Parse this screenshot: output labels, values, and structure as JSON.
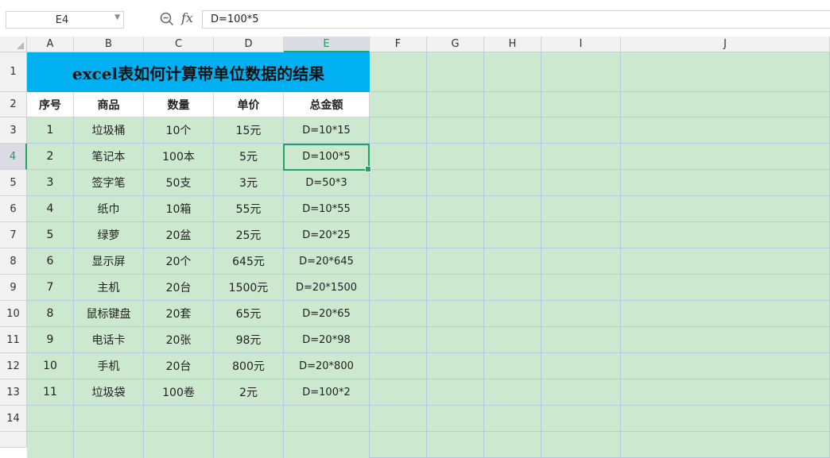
{
  "formula_bar": {
    "name_box": "E4",
    "fx_label": "fx",
    "formula": "D=100*5"
  },
  "columns": [
    "A",
    "B",
    "C",
    "D",
    "E",
    "F",
    "G",
    "H",
    "I",
    "J"
  ],
  "rows": [
    "1",
    "2",
    "3",
    "4",
    "5",
    "6",
    "7",
    "8",
    "9",
    "10",
    "11",
    "12",
    "13",
    "14"
  ],
  "active_cell": {
    "col": "E",
    "row": "4"
  },
  "sheet": {
    "title": "excel表如何计算带单位数据的结果",
    "headers": [
      "序号",
      "商品",
      "数量",
      "单价",
      "总金额"
    ],
    "data": [
      [
        "1",
        "垃圾桶",
        "10个",
        "15元",
        "D=10*15"
      ],
      [
        "2",
        "笔记本",
        "100本",
        "5元",
        "D=100*5"
      ],
      [
        "3",
        "签字笔",
        "50支",
        "3元",
        "D=50*3"
      ],
      [
        "4",
        "纸巾",
        "10箱",
        "55元",
        "D=10*55"
      ],
      [
        "5",
        "绿萝",
        "20盆",
        "25元",
        "D=20*25"
      ],
      [
        "6",
        "显示屏",
        "20个",
        "645元",
        "D=20*645"
      ],
      [
        "7",
        "主机",
        "20台",
        "1500元",
        "D=20*1500"
      ],
      [
        "8",
        "鼠标键盘",
        "20套",
        "65元",
        "D=20*65"
      ],
      [
        "9",
        "电话卡",
        "20张",
        "98元",
        "D=20*98"
      ],
      [
        "10",
        "手机",
        "20台",
        "800元",
        "D=20*800"
      ],
      [
        "11",
        "垃圾袋",
        "100卷",
        "2元",
        "D=100*2"
      ]
    ]
  },
  "colors": {
    "title_bg": "#00b0f0",
    "sheet_bg": "#cce8cf",
    "gridline": "#b7c9de",
    "selection": "#21a366"
  }
}
